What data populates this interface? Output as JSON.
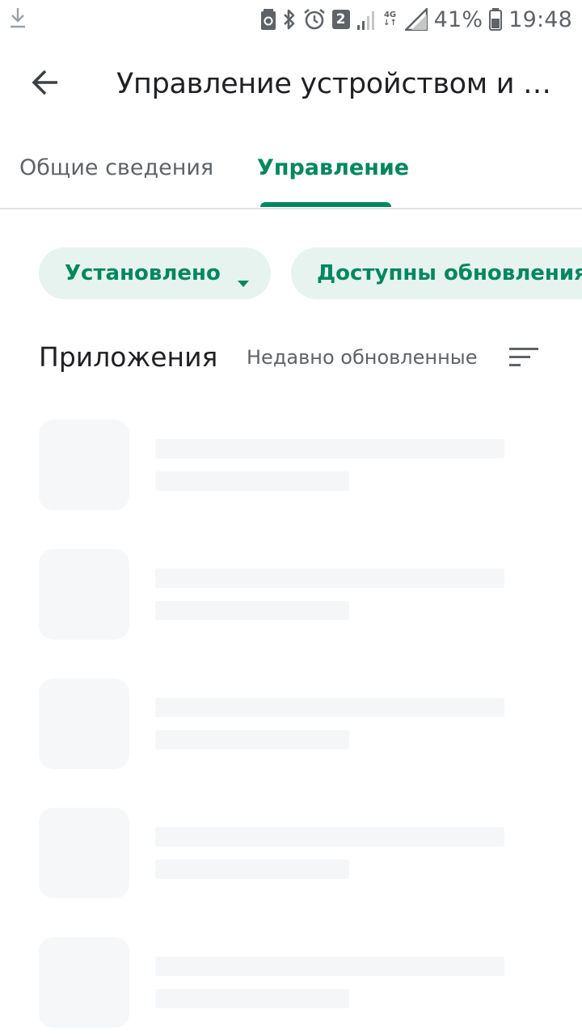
{
  "status_bar": {
    "battery_percent": "41%",
    "time": "19:48",
    "sim_badge": "2",
    "network_type": "4G",
    "icons": [
      "download-icon",
      "battery-saver-icon",
      "bluetooth-icon",
      "alarm-icon",
      "sim-badge",
      "signal-icon",
      "network-4g-icon",
      "wifi-icon",
      "battery-icon"
    ]
  },
  "app_bar": {
    "title": "Управление устройством и пр...",
    "back_icon": "arrow-back-icon"
  },
  "tabs": [
    {
      "label": "Общие сведения",
      "selected": false
    },
    {
      "label": "Управление",
      "selected": true
    }
  ],
  "filters": {
    "installed_label": "Установлено",
    "updates_label": "Доступны обновления"
  },
  "apps_section": {
    "title": "Приложения",
    "sort_label": "Недавно обновленные",
    "sort_icon": "sort-icon"
  },
  "placeholders_count_note": "loading skeleton rows",
  "colors": {
    "accent": "#01875f",
    "chip_background": "#e6f3ef",
    "text_primary": "#202124",
    "text_secondary": "#5f6368",
    "skeleton": "#f5f6f7"
  }
}
